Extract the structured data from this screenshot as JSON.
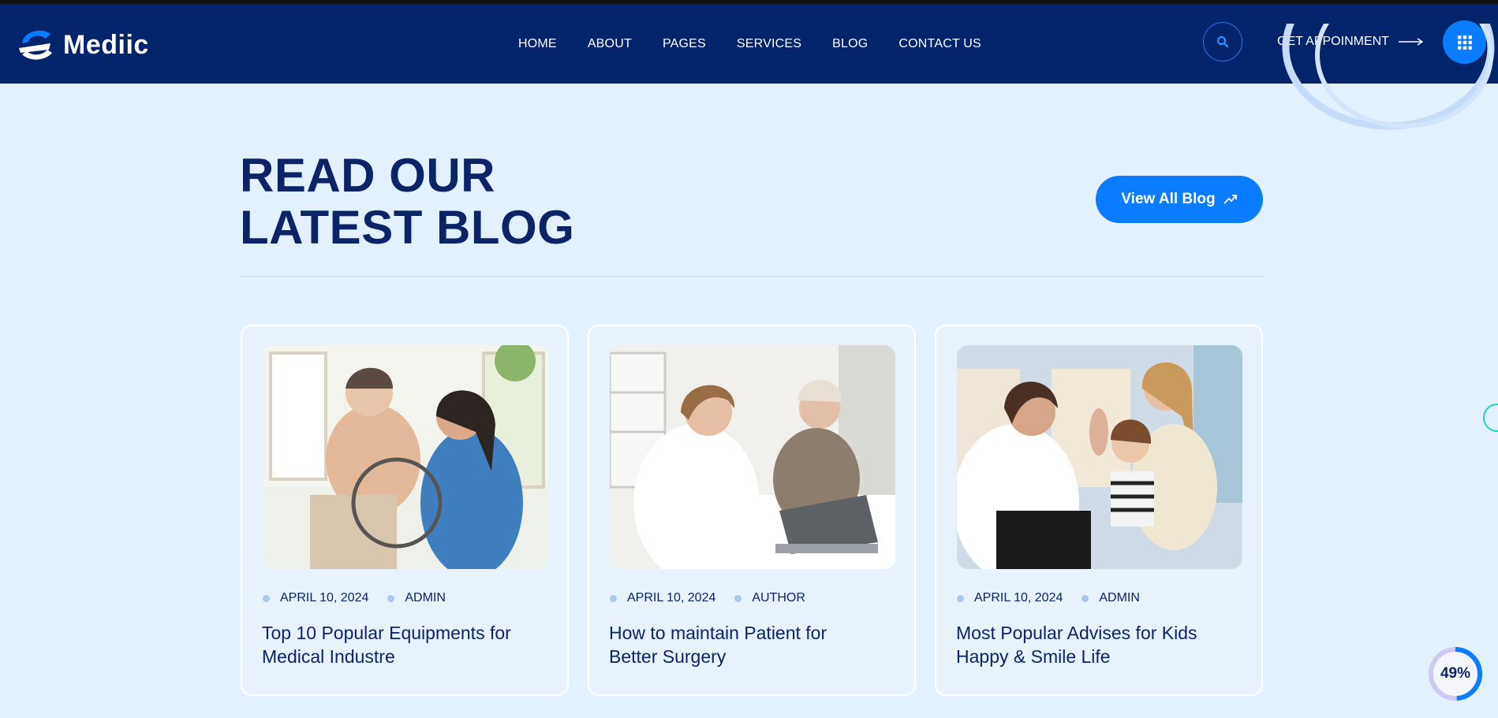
{
  "brand": {
    "name": "Mediic",
    "accent": "#0a7cff",
    "navy": "#01246b"
  },
  "nav": {
    "items": [
      "HOME",
      "ABOUT",
      "PAGES",
      "SERVICES",
      "BLOG",
      "CONTACT US"
    ]
  },
  "header_actions": {
    "search_icon": "search-icon",
    "appointment_label": "GET APPOINMENT",
    "menu_icon": "grid-menu-icon"
  },
  "section": {
    "title_line1": "READ OUR",
    "title_line2": "LATEST BLOG",
    "view_all_label": "View All Blog"
  },
  "posts": [
    {
      "date": "APRIL 10, 2024",
      "author": "ADMIN",
      "title": "Top 10 Popular Equipments for Medical Industre"
    },
    {
      "date": "APRIL 10, 2024",
      "author": "AUTHOR",
      "title": "How to maintain Patient for Better Surgery"
    },
    {
      "date": "APRIL 10, 2024",
      "author": "ADMIN",
      "title": "Most Popular Advises for Kids Happy & Smile Life"
    }
  ],
  "scroll_progress": {
    "label": "49%",
    "value": 0.49
  }
}
